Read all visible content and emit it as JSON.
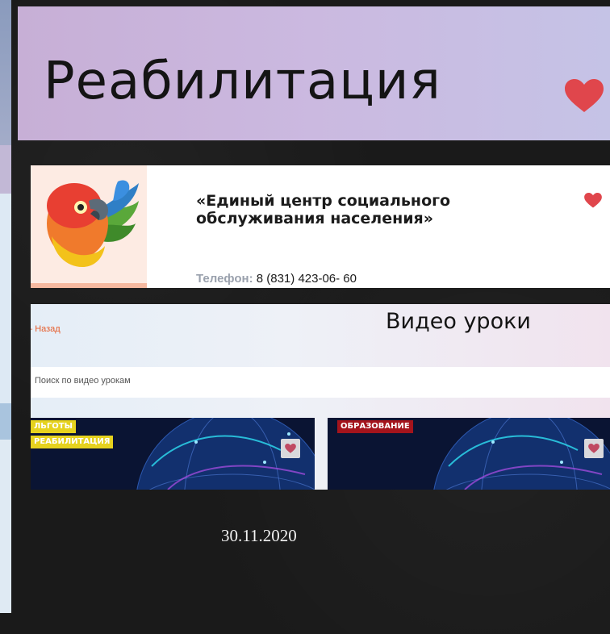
{
  "banner": {
    "title": "Реабилитация",
    "heart_icon": "heart-icon",
    "accent": "#e0464c"
  },
  "org": {
    "logo_icon": "parrot-logo-icon",
    "name": "«Единый центр социального обслуживания населения»",
    "heart_icon": "heart-icon",
    "phone_label": "Телефон:",
    "phone_value": " 8 (831) 423-06- 60"
  },
  "video": {
    "back_label": "Назад",
    "title": "Видео уроки",
    "search_placeholder": "Поиск по видео урокам",
    "cards": [
      {
        "tags": [
          "ЛЬГОТЫ",
          "РЕАБИЛИТАЦИЯ"
        ],
        "heart_icon": "heart-icon"
      },
      {
        "tags": [
          "ОБРАЗОВАНИЕ"
        ],
        "heart_icon": "heart-icon"
      }
    ],
    "tag_colors": {
      "yellow": "#e6d21e",
      "red": "#a4141c"
    }
  },
  "date": "30.11.2020"
}
